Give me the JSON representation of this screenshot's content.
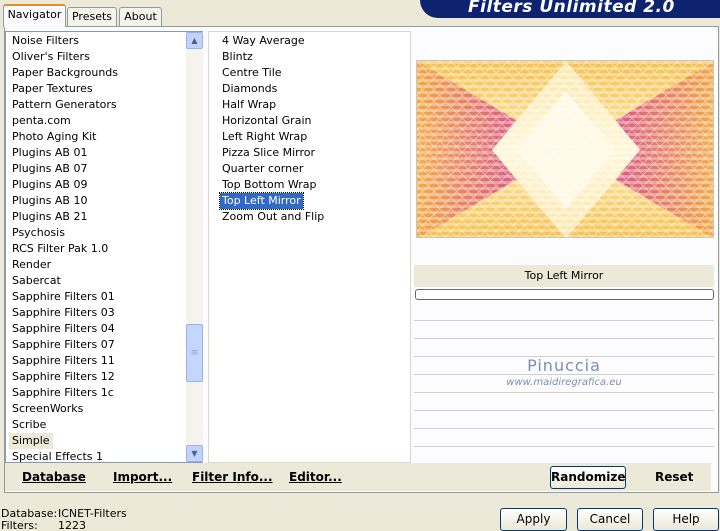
{
  "tabs": [
    {
      "label": "Navigator",
      "active": true
    },
    {
      "label": "Presets",
      "active": false
    },
    {
      "label": "About",
      "active": false
    }
  ],
  "banner": {
    "title": "Filters Unlimited 2.0"
  },
  "categories": [
    {
      "label": "Noise Filters"
    },
    {
      "label": "Oliver's Filters"
    },
    {
      "label": "Paper Backgrounds"
    },
    {
      "label": "Paper Textures"
    },
    {
      "label": "Pattern Generators"
    },
    {
      "label": "penta.com"
    },
    {
      "label": "Photo Aging Kit"
    },
    {
      "label": "Plugins AB 01"
    },
    {
      "label": "Plugins AB 07"
    },
    {
      "label": "Plugins AB 09"
    },
    {
      "label": "Plugins AB 10"
    },
    {
      "label": "Plugins AB 21"
    },
    {
      "label": "Psychosis"
    },
    {
      "label": "RCS Filter Pak 1.0"
    },
    {
      "label": "Render"
    },
    {
      "label": "Sabercat"
    },
    {
      "label": "Sapphire Filters 01"
    },
    {
      "label": "Sapphire Filters 03"
    },
    {
      "label": "Sapphire Filters 04"
    },
    {
      "label": "Sapphire Filters 07"
    },
    {
      "label": "Sapphire Filters 11"
    },
    {
      "label": "Sapphire Filters 12"
    },
    {
      "label": "Sapphire Filters 1c"
    },
    {
      "label": "ScreenWorks"
    },
    {
      "label": "Scribe"
    },
    {
      "label": "Simple",
      "selected": true
    },
    {
      "label": "Special Effects 1"
    }
  ],
  "filters": [
    {
      "label": "4 Way Average"
    },
    {
      "label": "Blintz"
    },
    {
      "label": "Centre Tile"
    },
    {
      "label": "Diamonds"
    },
    {
      "label": "Half Wrap"
    },
    {
      "label": "Horizontal Grain"
    },
    {
      "label": "Left Right Wrap"
    },
    {
      "label": "Pizza Slice Mirror"
    },
    {
      "label": "Quarter corner"
    },
    {
      "label": "Top Bottom Wrap"
    },
    {
      "label": "Top Left Mirror",
      "selected": true
    },
    {
      "label": "Zoom Out and Flip"
    }
  ],
  "preview": {
    "filter_name": "Top Left Mirror"
  },
  "watermark": {
    "name": "Pinuccia",
    "site": "www.maidiregrafica.eu"
  },
  "bottom_links": {
    "database": "Database",
    "import": "Import...",
    "filter_info": "Filter Info...",
    "editor": "Editor..."
  },
  "buttons": {
    "randomize": "Randomize",
    "reset": "Reset",
    "apply": "Apply",
    "cancel": "Cancel",
    "help": "Help"
  },
  "status": {
    "database_label": "Database:",
    "database_value": "ICNET-Filters",
    "filters_label": "Filters:",
    "filters_value": "1223"
  },
  "colors": {
    "selection": "#316ac5",
    "banner": "#0d2370",
    "tab_accent": "#e68b2c"
  }
}
